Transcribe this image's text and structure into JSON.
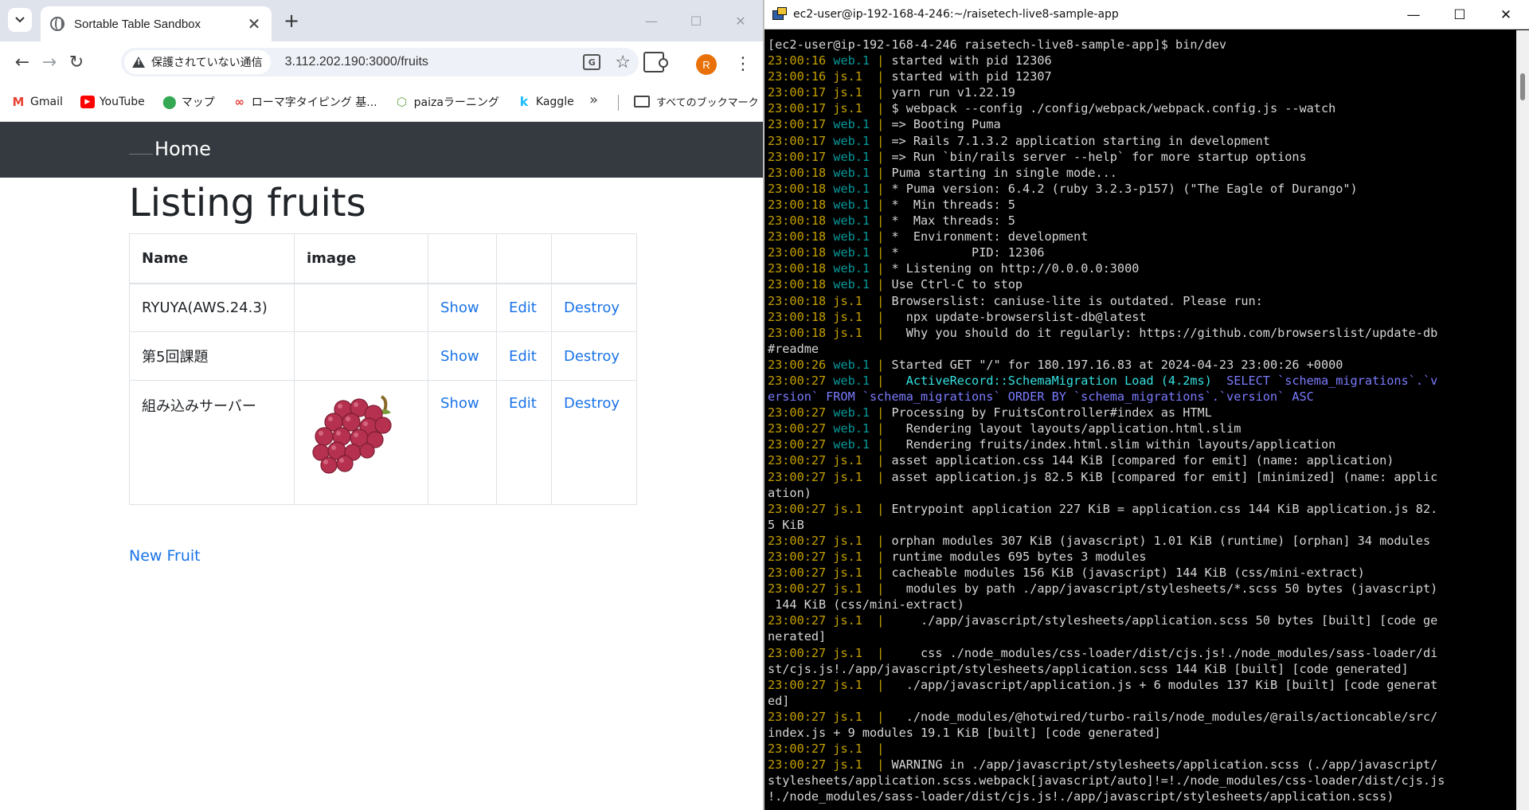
{
  "browser": {
    "tab_title": "Sortable Table Sandbox",
    "security_chip": "保護されていない通信",
    "url": "3.112.202.190:3000/fruits",
    "avatar_letter": "R",
    "bookmarks": [
      {
        "label": "Gmail",
        "icon": "gmail-icon",
        "color": "#ea4335"
      },
      {
        "label": "YouTube",
        "icon": "youtube-icon",
        "color": "#ff0000"
      },
      {
        "label": "マップ",
        "icon": "maps-icon",
        "color": "#34a853"
      },
      {
        "label": "ローマ字タイピング 基...",
        "icon": "typing-icon",
        "color": "#e53935"
      },
      {
        "label": "paizaラーニング",
        "icon": "paiza-icon",
        "color": "#6aa84f"
      },
      {
        "label": "Kaggle",
        "icon": "kaggle-icon",
        "color": "#20beff"
      }
    ],
    "all_bookmarks": "すべてのブックマーク"
  },
  "app": {
    "nav_home": "Home",
    "heading": "Listing fruits",
    "columns": [
      "Name",
      "image",
      "",
      "",
      ""
    ],
    "rows": [
      {
        "name": "RYUYA(AWS.24.3)",
        "show": "Show",
        "edit": "Edit",
        "destroy": "Destroy",
        "has_image": false
      },
      {
        "name": "第5回課題",
        "show": "Show",
        "edit": "Edit",
        "destroy": "Destroy",
        "has_image": false
      },
      {
        "name": "組み込みサーバー",
        "show": "Show",
        "edit": "Edit",
        "destroy": "Destroy",
        "has_image": true
      }
    ],
    "new_link": "New Fruit"
  },
  "terminal": {
    "title": "ec2-user@ip-192-168-4-246:~/raisetech-live8-sample-app",
    "colors": {
      "timestamp": "#c4a000",
      "web": "#06989a",
      "js": "#c4a000",
      "activerecord": "#34e2e2",
      "sql": "#7b7bff"
    },
    "lines": [
      {
        "t": "plain",
        "text": "[ec2-user@ip-192-168-4-246 raisetech-live8-sample-app]$ bin/dev"
      },
      {
        "t": "log",
        "ts": "23:00:16",
        "p": "web.1",
        "msg": "started with pid 12306"
      },
      {
        "t": "log",
        "ts": "23:00:16",
        "p": "js.1 ",
        "msg": "started with pid 12307"
      },
      {
        "t": "log",
        "ts": "23:00:17",
        "p": "js.1 ",
        "msg": "yarn run v1.22.19"
      },
      {
        "t": "log",
        "ts": "23:00:17",
        "p": "js.1 ",
        "msg": "$ webpack --config ./config/webpack/webpack.config.js --watch"
      },
      {
        "t": "log",
        "ts": "23:00:17",
        "p": "web.1",
        "msg": "=> Booting Puma"
      },
      {
        "t": "log",
        "ts": "23:00:17",
        "p": "web.1",
        "msg": "=> Rails 7.1.3.2 application starting in development"
      },
      {
        "t": "log",
        "ts": "23:00:17",
        "p": "web.1",
        "msg": "=> Run `bin/rails server --help` for more startup options"
      },
      {
        "t": "log",
        "ts": "23:00:18",
        "p": "web.1",
        "msg": "Puma starting in single mode..."
      },
      {
        "t": "log",
        "ts": "23:00:18",
        "p": "web.1",
        "msg": "* Puma version: 6.4.2 (ruby 3.2.3-p157) (\"The Eagle of Durango\")"
      },
      {
        "t": "log",
        "ts": "23:00:18",
        "p": "web.1",
        "msg": "*  Min threads: 5"
      },
      {
        "t": "log",
        "ts": "23:00:18",
        "p": "web.1",
        "msg": "*  Max threads: 5"
      },
      {
        "t": "log",
        "ts": "23:00:18",
        "p": "web.1",
        "msg": "*  Environment: development"
      },
      {
        "t": "log",
        "ts": "23:00:18",
        "p": "web.1",
        "msg": "*          PID: 12306"
      },
      {
        "t": "log",
        "ts": "23:00:18",
        "p": "web.1",
        "msg": "* Listening on http://0.0.0.0:3000"
      },
      {
        "t": "log",
        "ts": "23:00:18",
        "p": "web.1",
        "msg": "Use Ctrl-C to stop"
      },
      {
        "t": "log",
        "ts": "23:00:18",
        "p": "js.1 ",
        "msg": "Browserslist: caniuse-lite is outdated. Please run:"
      },
      {
        "t": "log",
        "ts": "23:00:18",
        "p": "js.1 ",
        "msg": "  npx update-browserslist-db@latest"
      },
      {
        "t": "log",
        "ts": "23:00:18",
        "p": "js.1 ",
        "msg": "  Why you should do it regularly: https://github.com/browserslist/update-db"
      },
      {
        "t": "plain",
        "text": "#readme"
      },
      {
        "t": "log",
        "ts": "23:00:26",
        "p": "web.1",
        "msg": "Started GET \"/\" for 180.197.16.83 at 2024-04-23 23:00:26 +0000"
      },
      {
        "t": "ar",
        "ts": "23:00:27",
        "p": "web.1",
        "ar": "  ActiveRecord::SchemaMigration Load (4.2ms)",
        "sql": "  SELECT `schema_migrations`.`v"
      },
      {
        "t": "sql",
        "text": "ersion` FROM `schema_migrations` ORDER BY `schema_migrations`.`version` ASC"
      },
      {
        "t": "log",
        "ts": "23:00:27",
        "p": "web.1",
        "msg": "Processing by FruitsController#index as HTML"
      },
      {
        "t": "log",
        "ts": "23:00:27",
        "p": "web.1",
        "msg": "  Rendering layout layouts/application.html.slim"
      },
      {
        "t": "log",
        "ts": "23:00:27",
        "p": "web.1",
        "msg": "  Rendering fruits/index.html.slim within layouts/application"
      },
      {
        "t": "log",
        "ts": "23:00:27",
        "p": "js.1 ",
        "msg": "asset application.css 144 KiB [compared for emit] (name: application)"
      },
      {
        "t": "log",
        "ts": "23:00:27",
        "p": "js.1 ",
        "msg": "asset application.js 82.5 KiB [compared for emit] [minimized] (name: applic"
      },
      {
        "t": "plain",
        "text": "ation)"
      },
      {
        "t": "log",
        "ts": "23:00:27",
        "p": "js.1 ",
        "msg": "Entrypoint application 227 KiB = application.css 144 KiB application.js 82."
      },
      {
        "t": "plain",
        "text": "5 KiB"
      },
      {
        "t": "log",
        "ts": "23:00:27",
        "p": "js.1 ",
        "msg": "orphan modules 307 KiB (javascript) 1.01 KiB (runtime) [orphan] 34 modules"
      },
      {
        "t": "log",
        "ts": "23:00:27",
        "p": "js.1 ",
        "msg": "runtime modules 695 bytes 3 modules"
      },
      {
        "t": "log",
        "ts": "23:00:27",
        "p": "js.1 ",
        "msg": "cacheable modules 156 KiB (javascript) 144 KiB (css/mini-extract)"
      },
      {
        "t": "log",
        "ts": "23:00:27",
        "p": "js.1 ",
        "msg": "  modules by path ./app/javascript/stylesheets/*.scss 50 bytes (javascript)"
      },
      {
        "t": "plain",
        "text": " 144 KiB (css/mini-extract)"
      },
      {
        "t": "log",
        "ts": "23:00:27",
        "p": "js.1 ",
        "msg": "    ./app/javascript/stylesheets/application.scss 50 bytes [built] [code ge"
      },
      {
        "t": "plain",
        "text": "nerated]"
      },
      {
        "t": "log",
        "ts": "23:00:27",
        "p": "js.1 ",
        "msg": "    css ./node_modules/css-loader/dist/cjs.js!./node_modules/sass-loader/di"
      },
      {
        "t": "plain",
        "text": "st/cjs.js!./app/javascript/stylesheets/application.scss 144 KiB [built] [code generated]"
      },
      {
        "t": "log",
        "ts": "23:00:27",
        "p": "js.1 ",
        "msg": "  ./app/javascript/application.js + 6 modules 137 KiB [built] [code generat"
      },
      {
        "t": "plain",
        "text": "ed]"
      },
      {
        "t": "log",
        "ts": "23:00:27",
        "p": "js.1 ",
        "msg": "  ./node_modules/@hotwired/turbo-rails/node_modules/@rails/actioncable/src/"
      },
      {
        "t": "plain",
        "text": "index.js + 9 modules 19.1 KiB [built] [code generated]"
      },
      {
        "t": "log",
        "ts": "23:00:27",
        "p": "js.1 ",
        "msg": ""
      },
      {
        "t": "log",
        "ts": "23:00:27",
        "p": "js.1 ",
        "msg": "WARNING in ./app/javascript/stylesheets/application.scss (./app/javascript/"
      },
      {
        "t": "plain",
        "text": "stylesheets/application.scss.webpack[javascript/auto]!=!./node_modules/css-loader/dist/cjs.js"
      },
      {
        "t": "plain",
        "text": "!./node_modules/sass-loader/dist/cjs.js!./app/javascript/stylesheets/application.scss)"
      }
    ]
  }
}
